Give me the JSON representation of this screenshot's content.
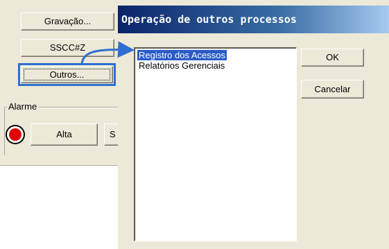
{
  "left_panel": {
    "buttons": {
      "gravacao": "Gravação...",
      "sscc": "SSCC#Z",
      "outros": "Outros..."
    },
    "alarm_group": {
      "label": "Alarme",
      "alta_label": "Alta",
      "s_label": "S"
    }
  },
  "dialog": {
    "title": "Operação de outros processos",
    "list_items": [
      "Registro dos Acessos",
      "Relatórios Gerenciais"
    ],
    "selected_index": 0,
    "ok_label": "OK",
    "cancel_label": "Cancelar"
  },
  "colors": {
    "title_bar_start": "#0a246a",
    "selection": "#2a5bc8",
    "highlight_frame": "#2e6fd1",
    "alarm_led": "#e00000"
  }
}
